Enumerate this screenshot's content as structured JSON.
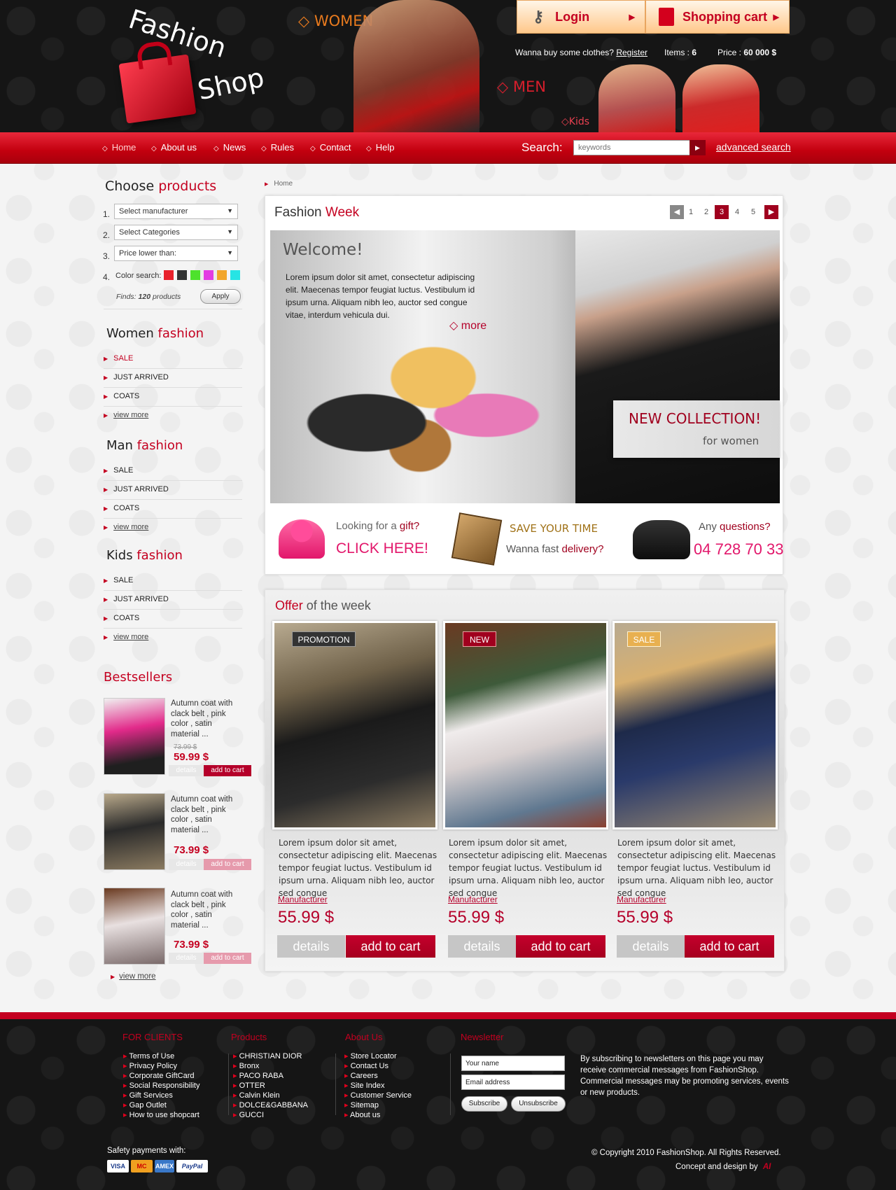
{
  "header": {
    "logo_line1": "Fashion",
    "logo_line2": "Shop",
    "cat_women": "◇ WOMEN",
    "cat_men": "◇ MEN",
    "cat_kids": "◇Kids",
    "login_label": "Login",
    "cart_label": "Shopping cart",
    "tagline": "Wanna buy some clothes?",
    "register_link": "Register",
    "items_label": "Items :",
    "items_count": "6",
    "price_label": "Price :",
    "price_value": "60 000 $"
  },
  "nav": {
    "items": [
      "Home",
      "About us",
      "News",
      "Rules",
      "Contact",
      "Help"
    ],
    "search_label": "Search:",
    "search_placeholder": "keywords",
    "advanced_search": "advanced search"
  },
  "sidebar": {
    "choose_title_a": "Choose",
    "choose_title_b": "products",
    "nums": [
      "1.",
      "2.",
      "3.",
      "4."
    ],
    "select_manufacturer": "Select manufacturer",
    "select_categories": "Select Categories",
    "select_price": "Price lower than:",
    "color_label": "Color search:",
    "colors": [
      "#e8212b",
      "#333333",
      "#4de22c",
      "#e33ce3",
      "#f2a52a",
      "#27e4e4"
    ],
    "finds_prefix": "Finds:",
    "finds_count": "120",
    "finds_suffix": "products",
    "apply": "Apply",
    "women_a": "Women",
    "women_b": "fashion",
    "man_a": "Man",
    "man_b": "fashion",
    "kids_a": "Kids",
    "kids_b": "fashion",
    "list": [
      "SALE",
      "JUST ARRIVED",
      "COATS",
      "view more"
    ],
    "bestsellers": "Bestsellers",
    "bs_desc": "Autumn coat with clack belt , pink color , satin material ...",
    "bs_old_price": "73.99 $",
    "bs_price1": "59.99 $",
    "bs_price2": "73.99 $",
    "bs_price3": "73.99 $",
    "bs_details": "details",
    "bs_add": "add to cart",
    "bs_more": "view more"
  },
  "breadcrumb": "Home",
  "fashion_week": {
    "title_a": "Fashion",
    "title_b": "Week",
    "pages": [
      "1",
      "2",
      "3",
      "4",
      "5"
    ],
    "current_page": "3",
    "welcome": "Welcome!",
    "welcome_text": "Lorem ipsum dolor sit amet, consectetur adipiscing elit. Maecenas tempor feugiat luctus. Vestibulum id ipsum urna. Aliquam nibh leo, auctor sed congue vitae, interdum vehicula dui.",
    "more": "◇ more",
    "new_collection": "NEW COLLECTION!",
    "for_women": "for women"
  },
  "promos": {
    "gift_a": "Looking for a",
    "gift_b": "gift?",
    "click_here": "CLICK HERE!",
    "save_time": "SAVE YOUR TIME",
    "delivery_a": "Wanna fast",
    "delivery_b": "delivery?",
    "questions_a": "Any",
    "questions_b": "questions?",
    "phone": "04 728 70 33"
  },
  "offer": {
    "title_a": "Offer",
    "title_b": "of the week",
    "products": [
      {
        "badge": "PROMOTION",
        "desc": "Lorem ipsum dolor sit amet, consectetur adipiscing elit. Maecenas tempor feugiat luctus. Vestibulum id ipsum urna. Aliquam nibh leo, auctor sed congue",
        "manufacturer": "Manufacturer",
        "price": "55.99 $",
        "details": "details",
        "add": "add to cart"
      },
      {
        "badge": "NEW",
        "desc": "Lorem ipsum dolor sit amet, consectetur adipiscing elit. Maecenas tempor feugiat luctus. Vestibulum id ipsum urna. Aliquam nibh leo, auctor sed congue",
        "manufacturer": "Manufacturer",
        "price": "55.99 $",
        "details": "details",
        "add": "add to cart"
      },
      {
        "badge": "SALE",
        "desc": "Lorem ipsum dolor sit amet, consectetur adipiscing elit. Maecenas tempor feugiat luctus. Vestibulum id ipsum urna. Aliquam nibh leo, auctor sed congue",
        "manufacturer": "Manufacturer",
        "price": "55.99 $",
        "details": "details",
        "add": "add to cart"
      }
    ]
  },
  "footer": {
    "clients_title": "FOR CLIENTS",
    "clients": [
      "Terms of Use",
      "Privacy Policy",
      "Corporate GiftCard",
      "Social Responsibility",
      "Gift Services",
      "Gap Outlet",
      "How to use shopcart"
    ],
    "products_title": "Products",
    "products": [
      "CHRISTIAN DIOR",
      "Bronx",
      "PACO RABA",
      "OTTER",
      "Calvin Klein",
      "DOLCE&GABBANA",
      "GUCCI"
    ],
    "about_title": "About Us",
    "about": [
      "Store Locator",
      "Contact Us",
      "Careers",
      "Site Index",
      "Customer Service",
      "Sitemap",
      "About us"
    ],
    "newsletter_title": "Newsletter",
    "name_field": "Your name",
    "email_field": "Email address",
    "subscribe": "Subscribe",
    "unsubscribe": "Unsubscribe",
    "newsletter_text": "By subscribing to newsletters on this page you may receive commercial messages from FashionShop. Commercial messages may be promoting services, events or new products.",
    "safety": "Safety payments with:",
    "cards": [
      "VISA",
      "MC",
      "AMEX",
      "PayPal"
    ],
    "copyright": "© Copyright 2010 FashionShop. All Rights Reserved.",
    "concept": "Concept and design by",
    "designer": "AI"
  },
  "colors": {
    "accent": "#c40020",
    "orange": "#e87a1e",
    "dark": "#151515"
  }
}
